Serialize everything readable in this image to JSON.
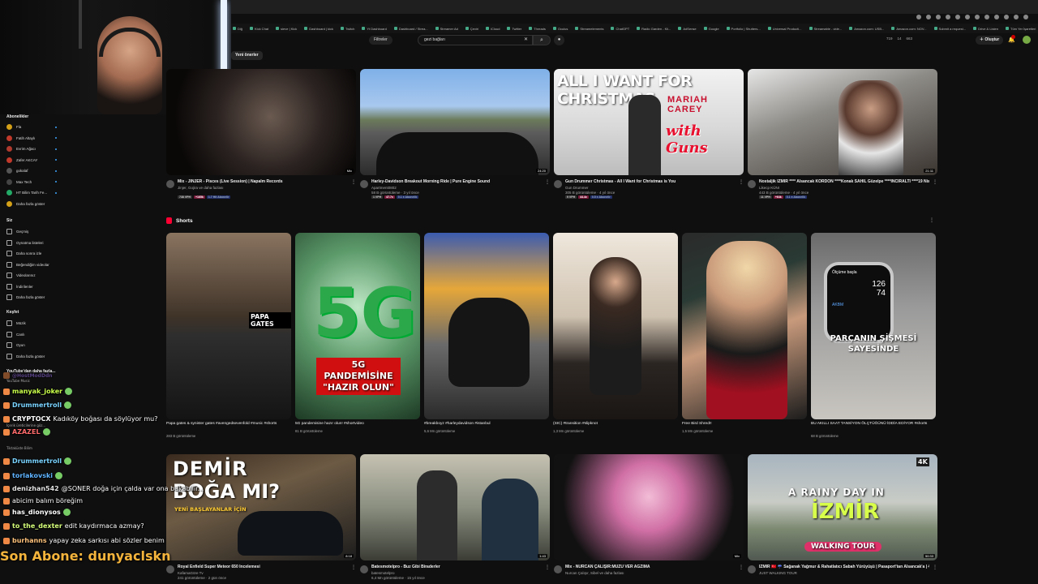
{
  "bookmarks": [
    "Diğ",
    "Kick Chat",
    "sieve | Kick",
    "Dashboard | kick",
    "Twitch",
    "Yt Dashboard",
    "Dashboard / Strea...",
    "Streamer Ad",
    "Çeviri",
    "iCloud",
    "Twitter",
    "Threads",
    "Oculus",
    "Streamelements",
    "ChatGPT",
    "Radio Garden - Kli...",
    "AdSense",
    "Google",
    "Portfolio | Shutters...",
    "Universal Producti...",
    "Streamable - vide...",
    "Amazon.com: USB...",
    "Amazon.com: NOV...",
    "Submit a request...",
    "Drive & Listen",
    "Tüm Yer İşaretleri"
  ],
  "header": {
    "filters": "Filtreler",
    "search_value": "gezi bağları",
    "stats": [
      "719",
      "14",
      "663"
    ],
    "create": "Oluştur"
  },
  "chips": [
    "Yeni önerler"
  ],
  "sidebar": {
    "subs_heading": "Abonelikler",
    "subs": [
      "Fla",
      "Fatih Altaylı",
      "Evrim Ağacı",
      "Zafer AKCAY",
      "gokalaf",
      "Max Tech",
      "HT Bilim Tarih Fe...",
      "Daha fazla göster"
    ],
    "you_heading": "Siz",
    "you": [
      "Geçmiş",
      "Oynatma listeleri",
      "Daha sonra izle",
      "Beğendiğim videolar",
      "Videolarınız",
      "İndirilenler",
      "Daha fazla göster"
    ],
    "explore_heading": "Keşfet",
    "explore": [
      "Müzik",
      "Canlı",
      "Oyun",
      "Daha fazla göster"
    ],
    "more_heading": "YouTube'dan daha fazla..."
  },
  "chat": [
    {
      "name": "@HostModDdn",
      "msg": "",
      "color": "#9b6ff0",
      "faded": true
    },
    {
      "name": "manyak_joker",
      "msg": "",
      "color": "#c9ff4a"
    },
    {
      "name": "Drummertroll",
      "msg": "",
      "color": "#7ad3ff"
    },
    {
      "name": "CRYPTOCX",
      "msg": "Kadıköy boğası da söylüyor mu?",
      "color": "#ffffff"
    },
    {
      "name": "AZAZEL",
      "msg": "",
      "color": "#ff6b6b"
    },
    {
      "name": "Drummertroll",
      "msg": "",
      "color": "#7ad3ff"
    },
    {
      "name": "torlakovski",
      "msg": "",
      "color": "#5fb3ff"
    },
    {
      "name": "denizhan542",
      "msg": "@SONER doğa için çalda var ona bakabilir...",
      "color": "#e0e0e0"
    },
    {
      "name": "",
      "msg": "abicim balım böreğim",
      "color": "#ffffff"
    },
    {
      "name": "has_dionysos",
      "msg": "",
      "color": "#ffffff"
    },
    {
      "name": "to_the_dexter",
      "msg": "edit kaydırmaca azmay?",
      "color": "#d6ff7a"
    },
    {
      "name": "burhanns",
      "msg": "yapay zeka sarkısı abi sözler benim",
      "color": "#ffc27a"
    }
  ],
  "chat_ghost": [
    "YouTube Music",
    "İçerik üreticilerine göz...",
    "Tiktaküste Bilim"
  ],
  "sub_alert": "Son Abone: dunyaclskn",
  "videos_row1": [
    {
      "title": "Mix - JINJER - Pisces (Live Session) | Napalm Records",
      "channel": "Jinjer, Gojira ve daha fazlası",
      "meta": "",
      "duration": "Mix",
      "badges": [
        "738 VPH",
        "+165k",
        "1.7 Hit Abonelir"
      ]
    },
    {
      "title": "Harley-Davidson Breakout Morning Ride | Pure Engine Sound",
      "channel": "Apartment0802",
      "meta": "58 B görüntüleme · 3 yıl önce",
      "duration": "24:20",
      "badges": [
        "1 VPH",
        "47.7x",
        "0.1 ± Abonelik"
      ]
    },
    {
      "title": "Gun Drummer Christmas - All I Want for Christmas is You",
      "channel": "Gun Drummer",
      "meta": "305 B görüntüleme · 4 yıl önce",
      "duration": "",
      "badges": [
        "9 VPH",
        "44.4x",
        "0.5 ± Abonelir"
      ]
    },
    {
      "title": "Nostaljik İZMİR **** Alsancak KORDON ****Konak SAHİL Güzelpe ****İNCİRALTI ****19 Nisan 1991****VTS 01 4",
      "channel": "Likecp KÜNI",
      "meta": "443 B görüntüleme · 4 yıl önce",
      "duration": "21:11",
      "badges": [
        "11 VPH",
        "+64k",
        "0.1 ± Abonelik"
      ]
    }
  ],
  "shorts_heading": "Shorts",
  "shorts": [
    {
      "title": "Papa gates & synister gates #avengedsevenfold #music #shorts",
      "views": "283 B görüntüleme",
      "overlay": "PAPA GATES"
    },
    {
      "title": "5G pandemisine hazır olun! #shortvideo",
      "views": "81 B görüntüleme",
      "overlay": "5G PANDEMİSİNE \"HAZIR OLUN\""
    },
    {
      "title": "#breakboyz #harleydavidson #istanbul",
      "views": "5,6 Mn görüntüleme",
      "overlay": ""
    },
    {
      "title": "(SIC) #transition #slipknot",
      "views": "1,3 Mn görüntüleme",
      "overlay": ""
    },
    {
      "title": "Free Bird Shred!!",
      "views": "1,5 Mn görüntüleme",
      "overlay": ""
    },
    {
      "title": "BU AKILLI SAAT TANSİYON ÖLÇTÜĞÜNÜ İDDİA EDİYOR #shorts",
      "views": "68 B görüntüleme",
      "overlay": "PARÇANIN ŞİŞMESİ SAYESİNDE"
    }
  ],
  "watch": {
    "l1": "Ölçüme başla",
    "v1": "126",
    "v2": "74",
    "l2": "AKBM"
  },
  "videos_row3": [
    {
      "title": "Royal Enfield Super Meteor 650 İncelemesi",
      "channel": "KafamaGöre Tv",
      "meta": "241 görüntüleme · 2 gün önce",
      "duration": "8:18",
      "overlay1": "DEMİR",
      "overlay2": "BOĞA MI?",
      "overlay3": "YENİ BAŞLAYANLAR İÇİN"
    },
    {
      "title": "Batesmotelpro - Buz Gibi Biraderler",
      "channel": "batesmotelpro",
      "meta": "6,4 Mn görüntüleme · 15 yıl önce",
      "duration": "1:43"
    },
    {
      "title": "Mix - NURCAN ÇALIŞIR:MUZU VER AĞZIMA",
      "channel": "Nurcan Çalışır, Sibel ve daha fazlası",
      "meta": "",
      "duration": "Mix"
    },
    {
      "title": "İZMİR 🇹🇷 ☔ Sağanak Yağmur & Rahatlatıcı Sabah Yürüyüşü | Pasaport'tan Alsancak'a | 4K 50FPS ASMR",
      "channel": "JUST WALKING TOUR",
      "meta": "",
      "duration": "50:33",
      "overlay1": "A RAINY DAY IN",
      "overlay2": "İZMİR",
      "overlay3": "WALKING TOUR",
      "tag": "4K"
    }
  ],
  "thumb_text": {
    "christmas1": "ALL I WANT FOR CHRISTMAS",
    "christmas2": "MARIAH CAREY",
    "christmas3": "with Guns",
    "fiveg": "5G"
  },
  "colors": {
    "bg": "#0f0f0f",
    "accent": "#ff0033",
    "sub_alert": "#f5b53c"
  }
}
